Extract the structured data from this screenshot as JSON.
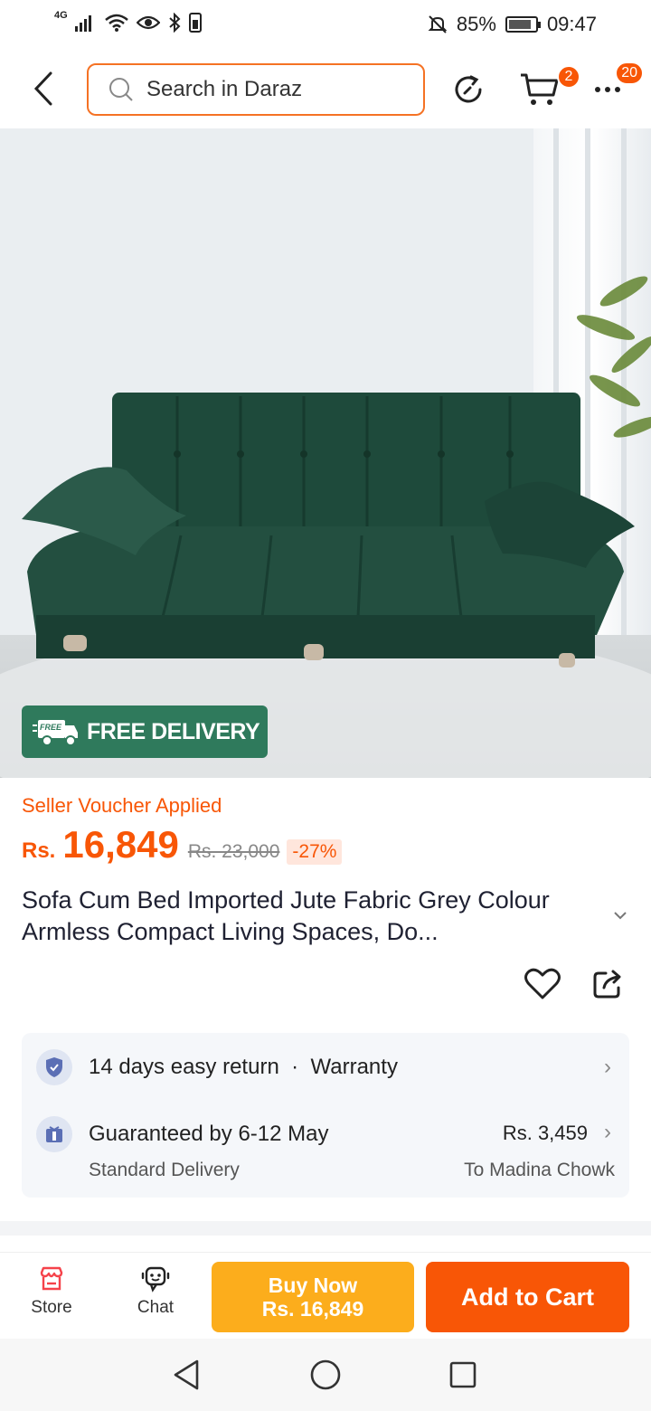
{
  "status_bar": {
    "network": "4G",
    "battery_percent": "85%",
    "battery_level": 0.85,
    "time": "09:47",
    "icons": [
      "signal-icon",
      "wifi-icon",
      "eye-icon",
      "bluetooth-icon",
      "sim-icon",
      "mute-icon",
      "battery-icon"
    ]
  },
  "header": {
    "search_placeholder": "Search in Daraz",
    "cart_badge": "2",
    "more_badge": "20"
  },
  "product_image": {
    "free_delivery_tag": "FREE",
    "free_delivery_label": "FREE DELIVERY"
  },
  "price": {
    "voucher_text": "Seller Voucher Applied",
    "currency": "Rs.",
    "current": "16,849",
    "original": "Rs. 23,000",
    "discount": "-27%"
  },
  "product": {
    "title": "Sofa Cum Bed Imported Jute Fabric Grey Colour Armless Compact Living Spaces, Do..."
  },
  "info": {
    "return_text": "14 days easy return",
    "separator": "·",
    "warranty_text": "Warranty",
    "delivery_text": "Guaranteed by 6-12 May",
    "delivery_type": "Standard Delivery",
    "delivery_price": "Rs. 3,459",
    "delivery_location": "To Madina Chowk"
  },
  "bottom_bar": {
    "store_label": "Store",
    "chat_label": "Chat",
    "buy_now_label": "Buy Now",
    "buy_now_price": "Rs. 16,849",
    "add_to_cart_label": "Add to Cart"
  },
  "colors": {
    "accent": "#f85606",
    "buy_now": "#fcad1c",
    "free_delivery": "#2f7a5c",
    "sofa": "#1f4a3b"
  }
}
